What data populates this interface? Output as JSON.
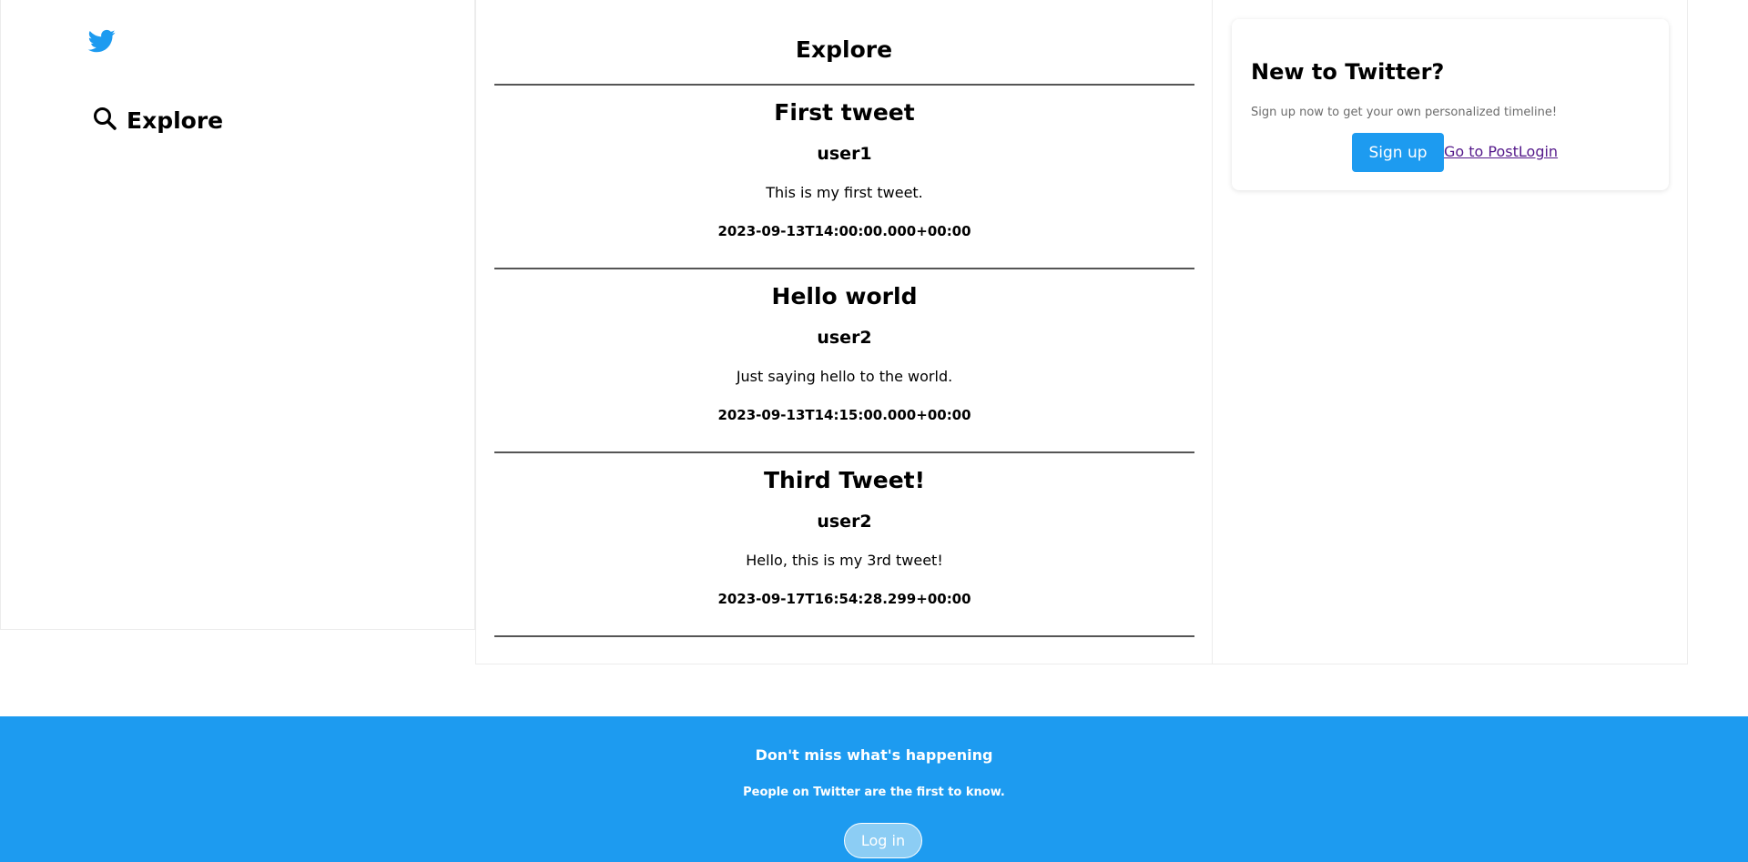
{
  "sidebar": {
    "logo_icon": "twitter-bird-icon",
    "nav_icon": "search-icon",
    "nav_explore_label": "Explore"
  },
  "main": {
    "title": "Explore",
    "tweets": [
      {
        "title": "First tweet",
        "user": "user1",
        "body": "This is my first tweet.",
        "date": "2023-09-13T14:00:00.000+00:00"
      },
      {
        "title": "Hello world",
        "user": "user2",
        "body": "Just saying hello to the world.",
        "date": "2023-09-13T14:15:00.000+00:00"
      },
      {
        "title": "Third Tweet!",
        "user": "user2",
        "body": "Hello, this is my 3rd tweet!",
        "date": "2023-09-17T16:54:28.299+00:00"
      }
    ]
  },
  "signup_card": {
    "title": "New to Twitter?",
    "subtitle": "Sign up now to get your own personalized timeline!",
    "signup_label": "Sign up",
    "login_link_label": "Go to PostLogin"
  },
  "banner": {
    "title": "Don't miss what's happening",
    "subtitle": "People on Twitter are the first to know.",
    "login_label": "Log in"
  },
  "colors": {
    "brand": "#1d9bf0",
    "link_visited": "#551a8b"
  }
}
